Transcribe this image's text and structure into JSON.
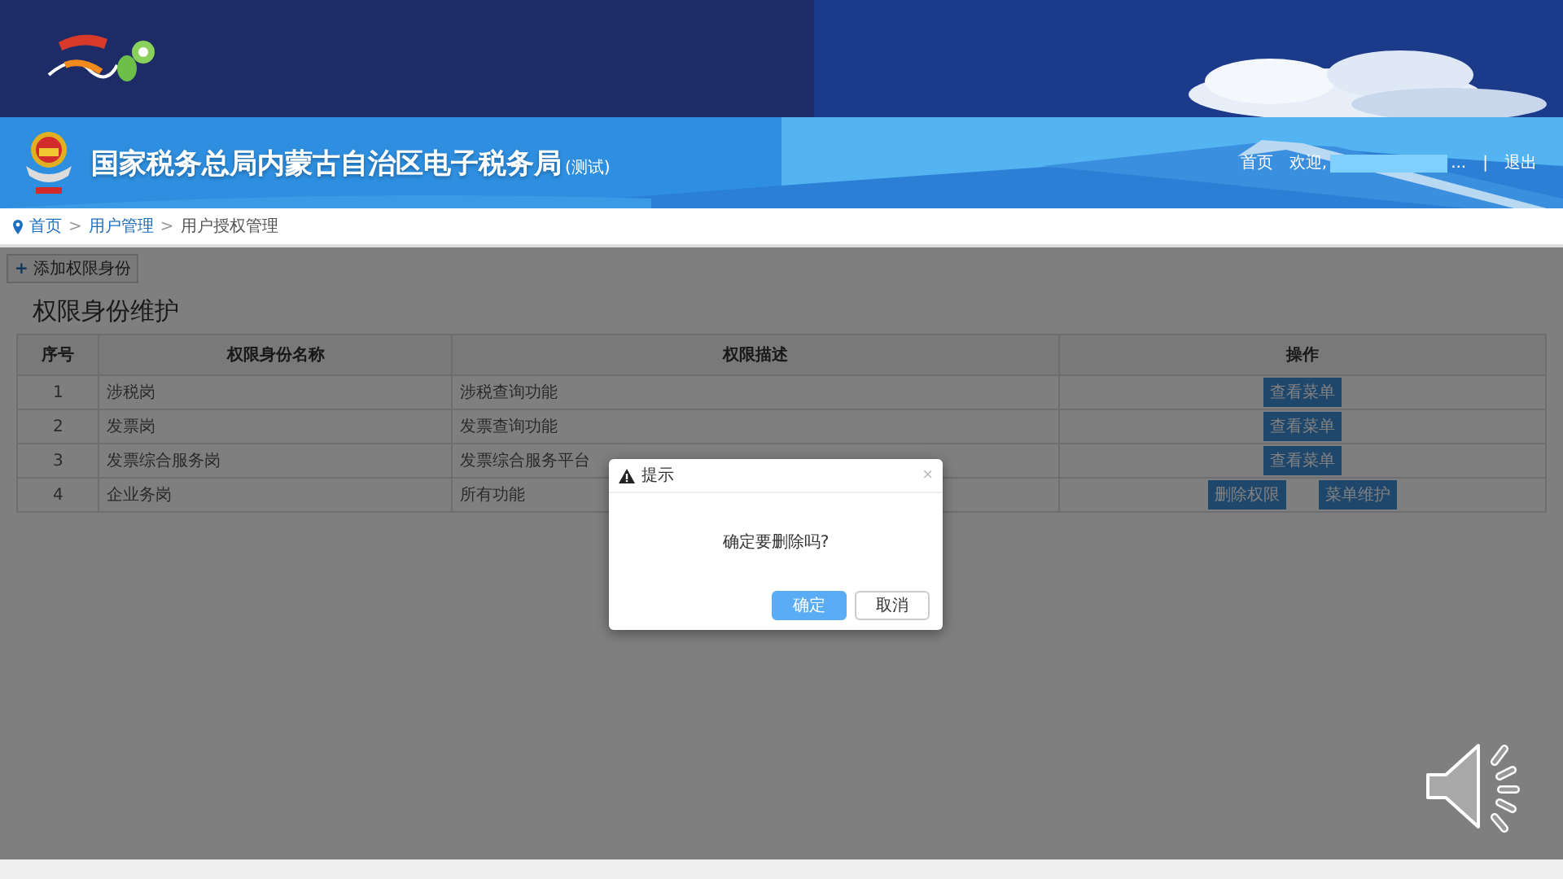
{
  "header": {
    "title": "国家税务总局内蒙古自治区电子税务局",
    "title_suffix": "(测试)",
    "home": "首页",
    "welcome": "欢迎,",
    "user_ellipsis": "...",
    "separator": "|",
    "logout": "退出"
  },
  "breadcrumb": {
    "separator": ">",
    "items": [
      {
        "label": "首页",
        "link": true
      },
      {
        "label": "用户管理",
        "link": true
      },
      {
        "label": "用户授权管理",
        "link": false
      }
    ]
  },
  "toolbar": {
    "add_icon": "+",
    "add_label": "添加权限身份"
  },
  "page_title": "权限身份维护",
  "table": {
    "columns": [
      "序号",
      "权限身份名称",
      "权限描述",
      "操作"
    ],
    "rows": [
      {
        "index": "1",
        "name": "涉税岗",
        "description": "涉税查询功能",
        "actions": [
          "查看菜单"
        ]
      },
      {
        "index": "2",
        "name": "发票岗",
        "description": "发票查询功能",
        "actions": [
          "查看菜单"
        ]
      },
      {
        "index": "3",
        "name": "发票综合服务岗",
        "description": "发票综合服务平台",
        "actions": [
          "查看菜单"
        ]
      },
      {
        "index": "4",
        "name": "企业务岗",
        "description": "所有功能",
        "actions": [
          "删除权限",
          "菜单维护"
        ]
      }
    ]
  },
  "dialog": {
    "title": "提示",
    "close": "×",
    "message": "确定要删除吗?",
    "buttons": [
      {
        "label": "确定",
        "kind": "primary"
      },
      {
        "label": "取消",
        "kind": "default"
      }
    ]
  }
}
